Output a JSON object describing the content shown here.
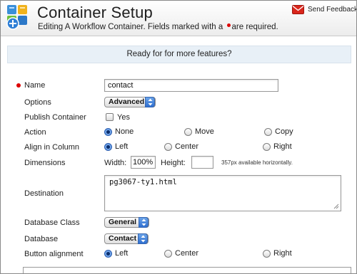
{
  "header": {
    "title": "Container Setup",
    "subtitle_prefix": "Editing A Workflow Container. Fields marked with a",
    "subtitle_suffix": "are required.",
    "feedback_label": "Send Feedback"
  },
  "banner": {
    "text": "Ready for for more features?"
  },
  "form": {
    "name": {
      "label": "Name",
      "value": "contact",
      "required": true
    },
    "options": {
      "label": "Options",
      "selected": "Advanced"
    },
    "publish": {
      "label": "Publish Container",
      "option_label": "Yes",
      "checked": false
    },
    "action": {
      "label": "Action",
      "options": [
        "None",
        "Move",
        "Copy"
      ],
      "selected": "None"
    },
    "align": {
      "label": "Align in Column",
      "options": [
        "Left",
        "Center",
        "Right"
      ],
      "selected": "Left"
    },
    "dimensions": {
      "label": "Dimensions",
      "width_label": "Width:",
      "width_value": "100%",
      "height_label": "Height:",
      "height_value": "",
      "note": "357px available horizontally."
    },
    "destination": {
      "label": "Destination",
      "value": "pg3067-ty1.html"
    },
    "database_class": {
      "label": "Database Class",
      "selected": "General"
    },
    "database": {
      "label": "Database",
      "selected": "Contact"
    },
    "button_alignment": {
      "label": "Button alignment",
      "options": [
        "Left",
        "Center",
        "Right"
      ],
      "selected": "Left"
    }
  },
  "colors": {
    "required": "#dd0000",
    "accent": "#2f6fd0",
    "banner_bg": "#e8f0f7"
  },
  "icons": {
    "app": "container-setup-icon",
    "feedback": "mail-icon",
    "select_arrow": "select-arrows-icon"
  }
}
